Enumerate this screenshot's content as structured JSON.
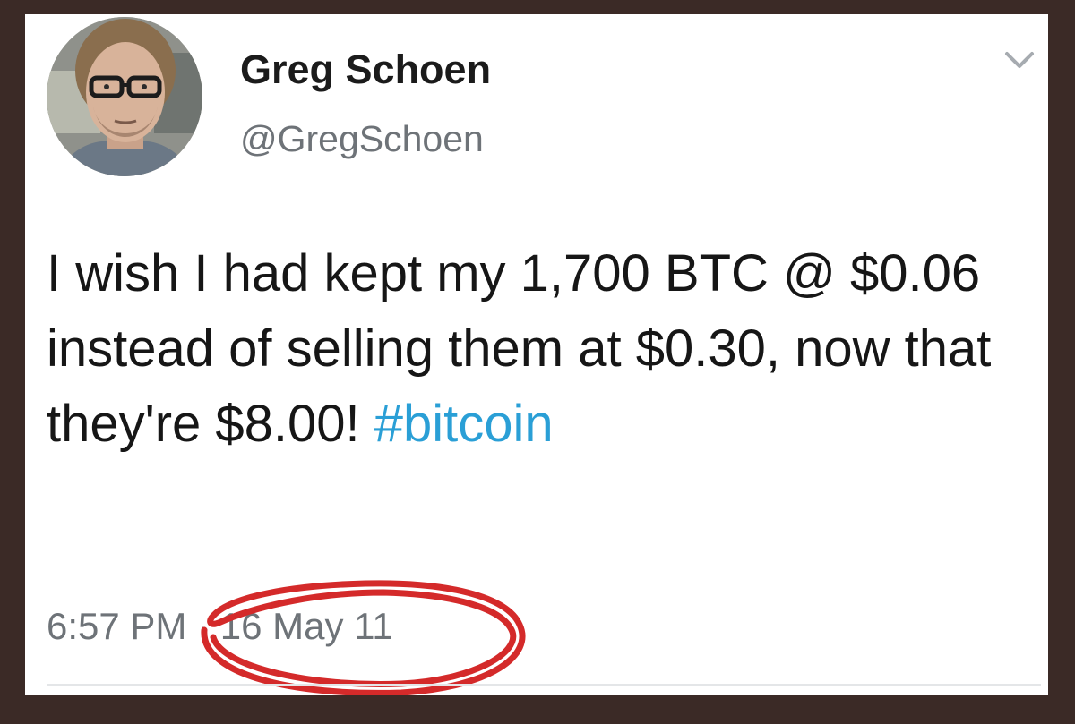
{
  "tweet": {
    "display_name": "Greg Schoen",
    "handle": "@GregSchoen",
    "text_before_hashtag": "I wish I had kept my 1,700 BTC @ $0.06 instead of selling them at $0.30, now that they're $8.00! ",
    "hashtag": "#bitcoin",
    "time": "6:57 PM",
    "separator": " · ",
    "date": "16 May 11"
  },
  "icons": {
    "menu": "chevron-down-icon",
    "avatar": "avatar"
  },
  "colors": {
    "background": "#3b2a26",
    "card": "#ffffff",
    "text": "#161616",
    "muted": "#6e7378",
    "link": "#2a9fd6",
    "annotation": "#d42a2a"
  }
}
